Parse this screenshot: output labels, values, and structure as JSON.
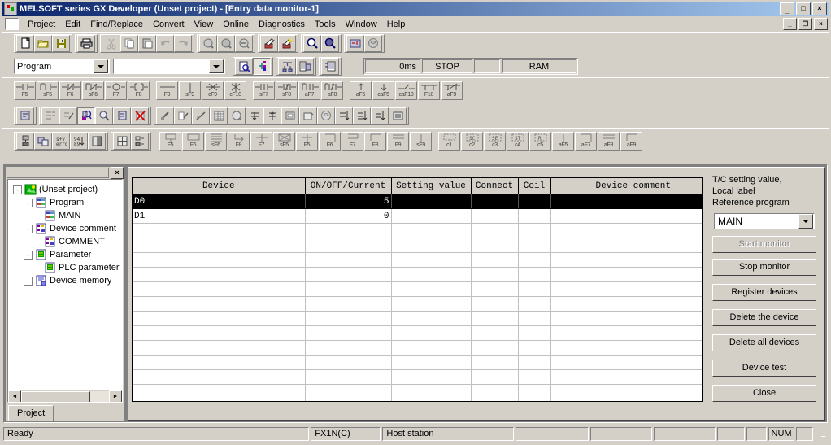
{
  "window": {
    "title": "MELSOFT series GX Developer (Unset project) - [Entry data monitor-1]",
    "app_icon": "melsoft-icon",
    "minimize": "_",
    "maximize": "□",
    "close": "×",
    "mdi_minimize": "_",
    "mdi_restore": "❐",
    "mdi_close": "×"
  },
  "menu": {
    "items": [
      {
        "label": "Project"
      },
      {
        "label": "Edit"
      },
      {
        "label": "Find/Replace"
      },
      {
        "label": "Convert"
      },
      {
        "label": "View"
      },
      {
        "label": "Online"
      },
      {
        "label": "Diagnostics"
      },
      {
        "label": "Tools"
      },
      {
        "label": "Window"
      },
      {
        "label": "Help"
      }
    ]
  },
  "toolbar_main": {
    "groups": [
      {
        "icons": [
          "new-file-icon",
          "open-folder-icon",
          "save-icon"
        ]
      },
      {
        "icons": [
          "print-icon"
        ]
      },
      {
        "icons": [
          "cut-icon",
          "copy-icon",
          "paste-icon",
          "undo-icon",
          "redo-icon"
        ]
      },
      {
        "icons": [
          "find-device-icon",
          "find-instruction-icon",
          "find-contact-icon"
        ]
      },
      {
        "icons": [
          "convert-icon",
          "convert-all-icon"
        ]
      },
      {
        "icons": [
          "zoom-in-icon",
          "zoom-out-icon"
        ]
      },
      {
        "icons": [
          "ladder-block-icon",
          "comment-icon"
        ]
      }
    ]
  },
  "toolbar_program": {
    "mode_combo": {
      "value": "Program"
    },
    "data_combo": {
      "value": ""
    },
    "icons": [
      "write-mode-icon",
      "monitor-mode-icon"
    ],
    "icons2": [
      "device-batch-icon",
      "entry-data-monitor-icon"
    ],
    "icons3": [
      "device-test-icon"
    ],
    "status": {
      "scan_time": "0ms",
      "plc_state": "STOP",
      "blank": "",
      "memory": "RAM"
    }
  },
  "toolbar_ladder": {
    "groups": [
      [
        {
          "glyph": "contact-no",
          "key": "F5"
        },
        {
          "glyph": "contact-no-parallel",
          "key": "sF5"
        },
        {
          "glyph": "contact-nc",
          "key": "F6"
        },
        {
          "glyph": "contact-nc-parallel",
          "key": "sF6"
        },
        {
          "glyph": "coil",
          "key": "F7"
        },
        {
          "glyph": "application-instruction",
          "key": "F8"
        }
      ],
      [
        {
          "glyph": "h-line",
          "key": "F9"
        },
        {
          "glyph": "v-line",
          "key": "sF9"
        },
        {
          "glyph": "delete-h-line",
          "key": "cF9"
        },
        {
          "glyph": "delete-v-line",
          "key": "cF10"
        }
      ],
      [
        {
          "glyph": "pulse-rising-contact",
          "key": "sF7"
        },
        {
          "glyph": "pulse-falling-contact",
          "key": "sF8"
        },
        {
          "glyph": "pulse-rising-parallel",
          "key": "aF7"
        },
        {
          "glyph": "pulse-falling-parallel",
          "key": "aF8"
        }
      ],
      [
        {
          "glyph": "operation-rising",
          "key": "aF5"
        },
        {
          "glyph": "operation-falling",
          "key": "caF5"
        },
        {
          "glyph": "invert-operation",
          "key": "caF10"
        },
        {
          "glyph": "rising-pulse-branch",
          "key": "F10"
        },
        {
          "glyph": "falling-pulse-branch",
          "key": "aF9"
        }
      ]
    ]
  },
  "toolbar_tools": {
    "groups": [
      {
        "icons": [
          "program-check-icon"
        ]
      },
      {
        "icons": [
          "ladder-convert-icon",
          "ladder-convert-run-icon",
          "monitor-glass-icon",
          "monitor-stop-icon",
          "device-monitor-icon",
          "monitor-cancel-icon"
        ]
      },
      {
        "icons": [
          "cut-ladder-icon",
          "edit-ladder-icon",
          "draw-line-icon",
          "list-display-icon",
          "device-search-icon",
          "step-up-icon",
          "step-down-icon",
          "window-tile-icon",
          "window-cascade-icon",
          "help-circle-icon",
          "sort-asc-icon",
          "sort-mid-icon",
          "sort-desc-icon",
          "memory-icon"
        ]
      }
    ]
  },
  "toolbar_sfc": {
    "groups": [
      {
        "icons": [
          "sfc-block-icon",
          "sfc-paste-icon",
          "error-check-icon",
          "sort-number-icon",
          "block-list-icon",
          "grid-icon",
          "block-tree-icon"
        ]
      },
      {
        "keys": [
          {
            "glyph": "sfc-step",
            "key": "F5"
          },
          {
            "glyph": "sfc-block-step",
            "key": "F6"
          },
          {
            "glyph": "sfc-series",
            "key": "sF6"
          },
          {
            "glyph": "sfc-jump",
            "key": "F8"
          },
          {
            "glyph": "sfc-transition",
            "key": "F7"
          },
          {
            "glyph": "sfc-selective",
            "key": "sF5"
          },
          {
            "glyph": "sfc-branch",
            "key": "F5"
          },
          {
            "glyph": "sfc-vertical",
            "key": "F6"
          },
          {
            "glyph": "sfc-corner",
            "key": "F7"
          },
          {
            "glyph": "sfc-end-step",
            "key": "F8"
          },
          {
            "glyph": "sfc-parallel",
            "key": "F9"
          },
          {
            "glyph": "sfc-line",
            "key": "sF9"
          }
        ]
      },
      {
        "keys2": [
          {
            "glyph": "dashed-box",
            "key": "c1"
          },
          {
            "glyph": "sc-box",
            "key": "c2"
          },
          {
            "glyph": "se-box",
            "key": "c3"
          },
          {
            "glyph": "st-box",
            "key": "c4"
          },
          {
            "glyph": "r-box",
            "key": "c5"
          },
          {
            "glyph": "vertical-a",
            "key": "aF5"
          },
          {
            "glyph": "corner-a",
            "key": "aF7"
          },
          {
            "glyph": "double-a",
            "key": "aF8"
          },
          {
            "glyph": "end-a",
            "key": "aF9"
          }
        ]
      }
    ]
  },
  "project_panel": {
    "close_label": "×",
    "tab_label": "Project",
    "scroll_left": "◄",
    "scroll_right": "►",
    "tree": [
      {
        "label": "(Unset project)",
        "depth": 0,
        "expander": "-",
        "icon": "project-root-icon"
      },
      {
        "label": "Program",
        "depth": 1,
        "expander": "-",
        "icon": "program-folder-icon"
      },
      {
        "label": "MAIN",
        "depth": 2,
        "expander": "",
        "icon": "program-file-icon"
      },
      {
        "label": "Device comment",
        "depth": 1,
        "expander": "-",
        "icon": "comment-folder-icon"
      },
      {
        "label": "COMMENT",
        "depth": 2,
        "expander": "",
        "icon": "comment-file-icon"
      },
      {
        "label": "Parameter",
        "depth": 1,
        "expander": "-",
        "icon": "parameter-folder-icon"
      },
      {
        "label": "PLC parameter",
        "depth": 2,
        "expander": "",
        "icon": "plc-parameter-icon"
      },
      {
        "label": "Device memory",
        "depth": 1,
        "expander": "+",
        "icon": "device-memory-icon"
      }
    ]
  },
  "monitor": {
    "columns": [
      "Device",
      "ON/OFF/Current",
      "Setting value",
      "Connect",
      "Coil",
      "Device comment"
    ],
    "rows": [
      {
        "device": "D0",
        "value": "5",
        "setting": "",
        "connect": "",
        "coil": "",
        "comment": "",
        "selected": true
      },
      {
        "device": "D1",
        "value": "0",
        "setting": "",
        "connect": "",
        "coil": "",
        "comment": "",
        "selected": false
      }
    ],
    "empty_row_count": 13
  },
  "monitor_panel": {
    "title_line1": "T/C setting value,",
    "title_line2": "Local label",
    "title_line3": "Reference program",
    "program_combo": {
      "value": "MAIN"
    },
    "buttons": [
      {
        "label": "Start monitor",
        "disabled": true,
        "name": "start-monitor-button"
      },
      {
        "label": "Stop monitor",
        "disabled": false,
        "name": "stop-monitor-button"
      },
      {
        "label": "Register devices",
        "disabled": false,
        "name": "register-devices-button"
      },
      {
        "label": "Delete the device",
        "disabled": false,
        "name": "delete-the-device-button"
      },
      {
        "label": "Delete all devices",
        "disabled": false,
        "name": "delete-all-devices-button"
      },
      {
        "label": "Device test",
        "disabled": false,
        "name": "device-test-button"
      },
      {
        "label": "Close",
        "disabled": false,
        "name": "close-button"
      }
    ]
  },
  "statusbar": {
    "ready": "Ready",
    "plc_type": "FX1N(C)",
    "station": "Host station",
    "f1": "",
    "f2": "",
    "f3": "",
    "f4": "",
    "f5": "",
    "num": "NUM",
    "f6": ""
  },
  "colors": {
    "face": "#d4d0c8",
    "title_start": "#0a246a",
    "title_end": "#a6caf0",
    "selection": "#000000",
    "grid_line": "#c0c0c0"
  }
}
